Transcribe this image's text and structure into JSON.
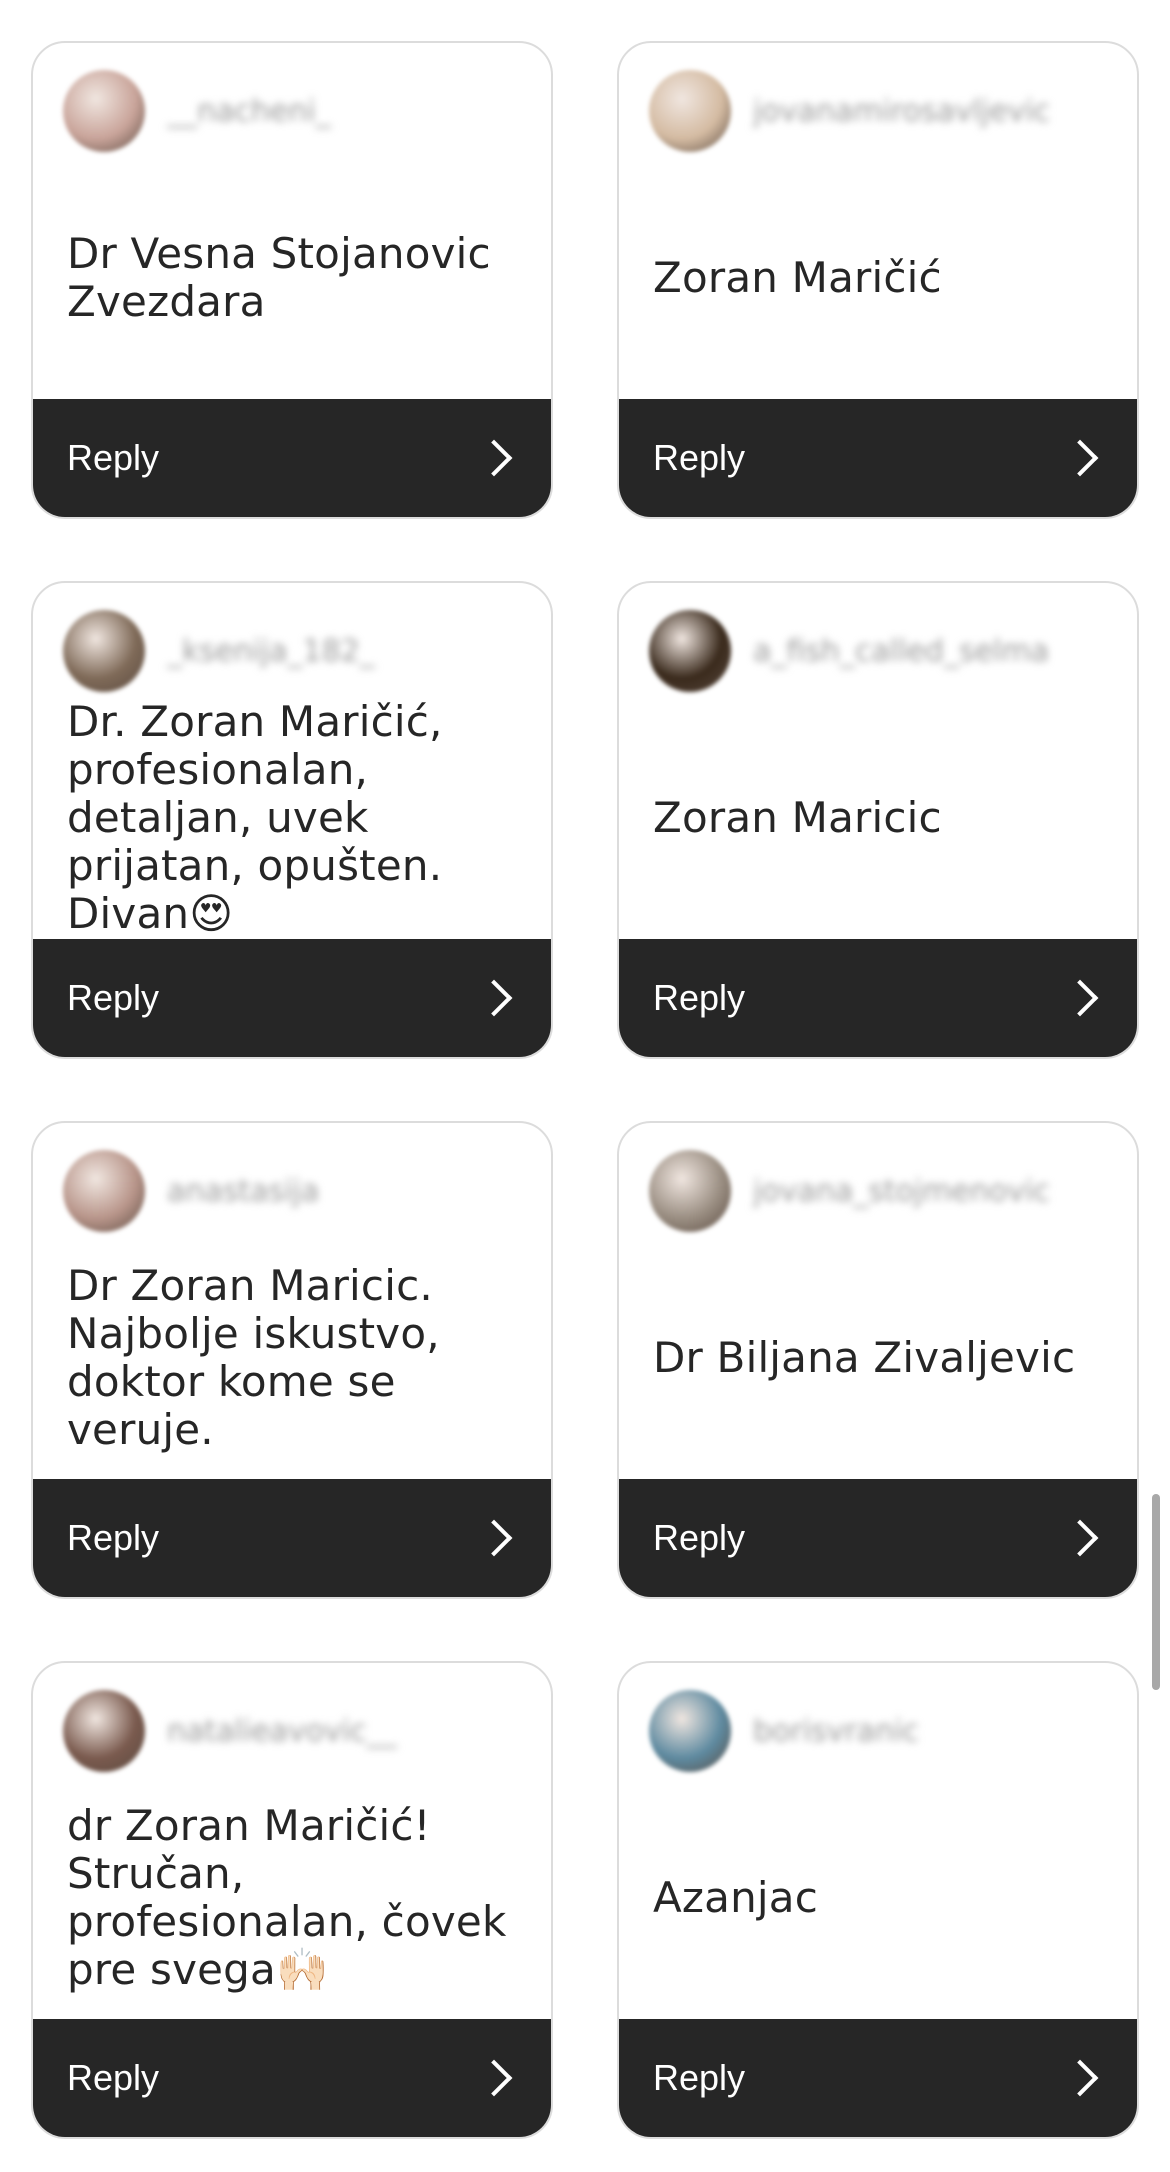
{
  "reply_label": "Reply",
  "cards": [
    {
      "username": "__nacheni_",
      "message": "Dr Vesna Stojanovic Zvezdara",
      "avatar_color": "#c9a49a"
    },
    {
      "username": "jovanamirosavljevic",
      "message": "Zoran Maričić",
      "avatar_color": "#d4bba2"
    },
    {
      "username": "_ksenija_182_",
      "message": "Dr. Zoran Maričić, profesionalan, detaljan, uvek prijatan, opušten. Divan😍",
      "avatar_color": "#7f6a58"
    },
    {
      "username": "a_fish_called_selma",
      "message": "Zoran Maricic",
      "avatar_color": "#3a2a1c"
    },
    {
      "username": "anastasija",
      "message": "Dr Zoran Maricic. Najbolje iskustvo, doktor kome se veruje.",
      "avatar_color": "#b8958a"
    },
    {
      "username": "jovana_stojmenovic",
      "message": "Dr Biljana Zivaljevic",
      "avatar_color": "#9a8e82"
    },
    {
      "username": "natalieavovic__",
      "message": "dr Zoran Maričić! Stručan, profesionalan, čovek pre svega🙌🏻",
      "avatar_color": "#7a5a4e"
    },
    {
      "username": "borisvranic",
      "message": "Azanjac",
      "avatar_color": "#5e8aa0"
    }
  ]
}
